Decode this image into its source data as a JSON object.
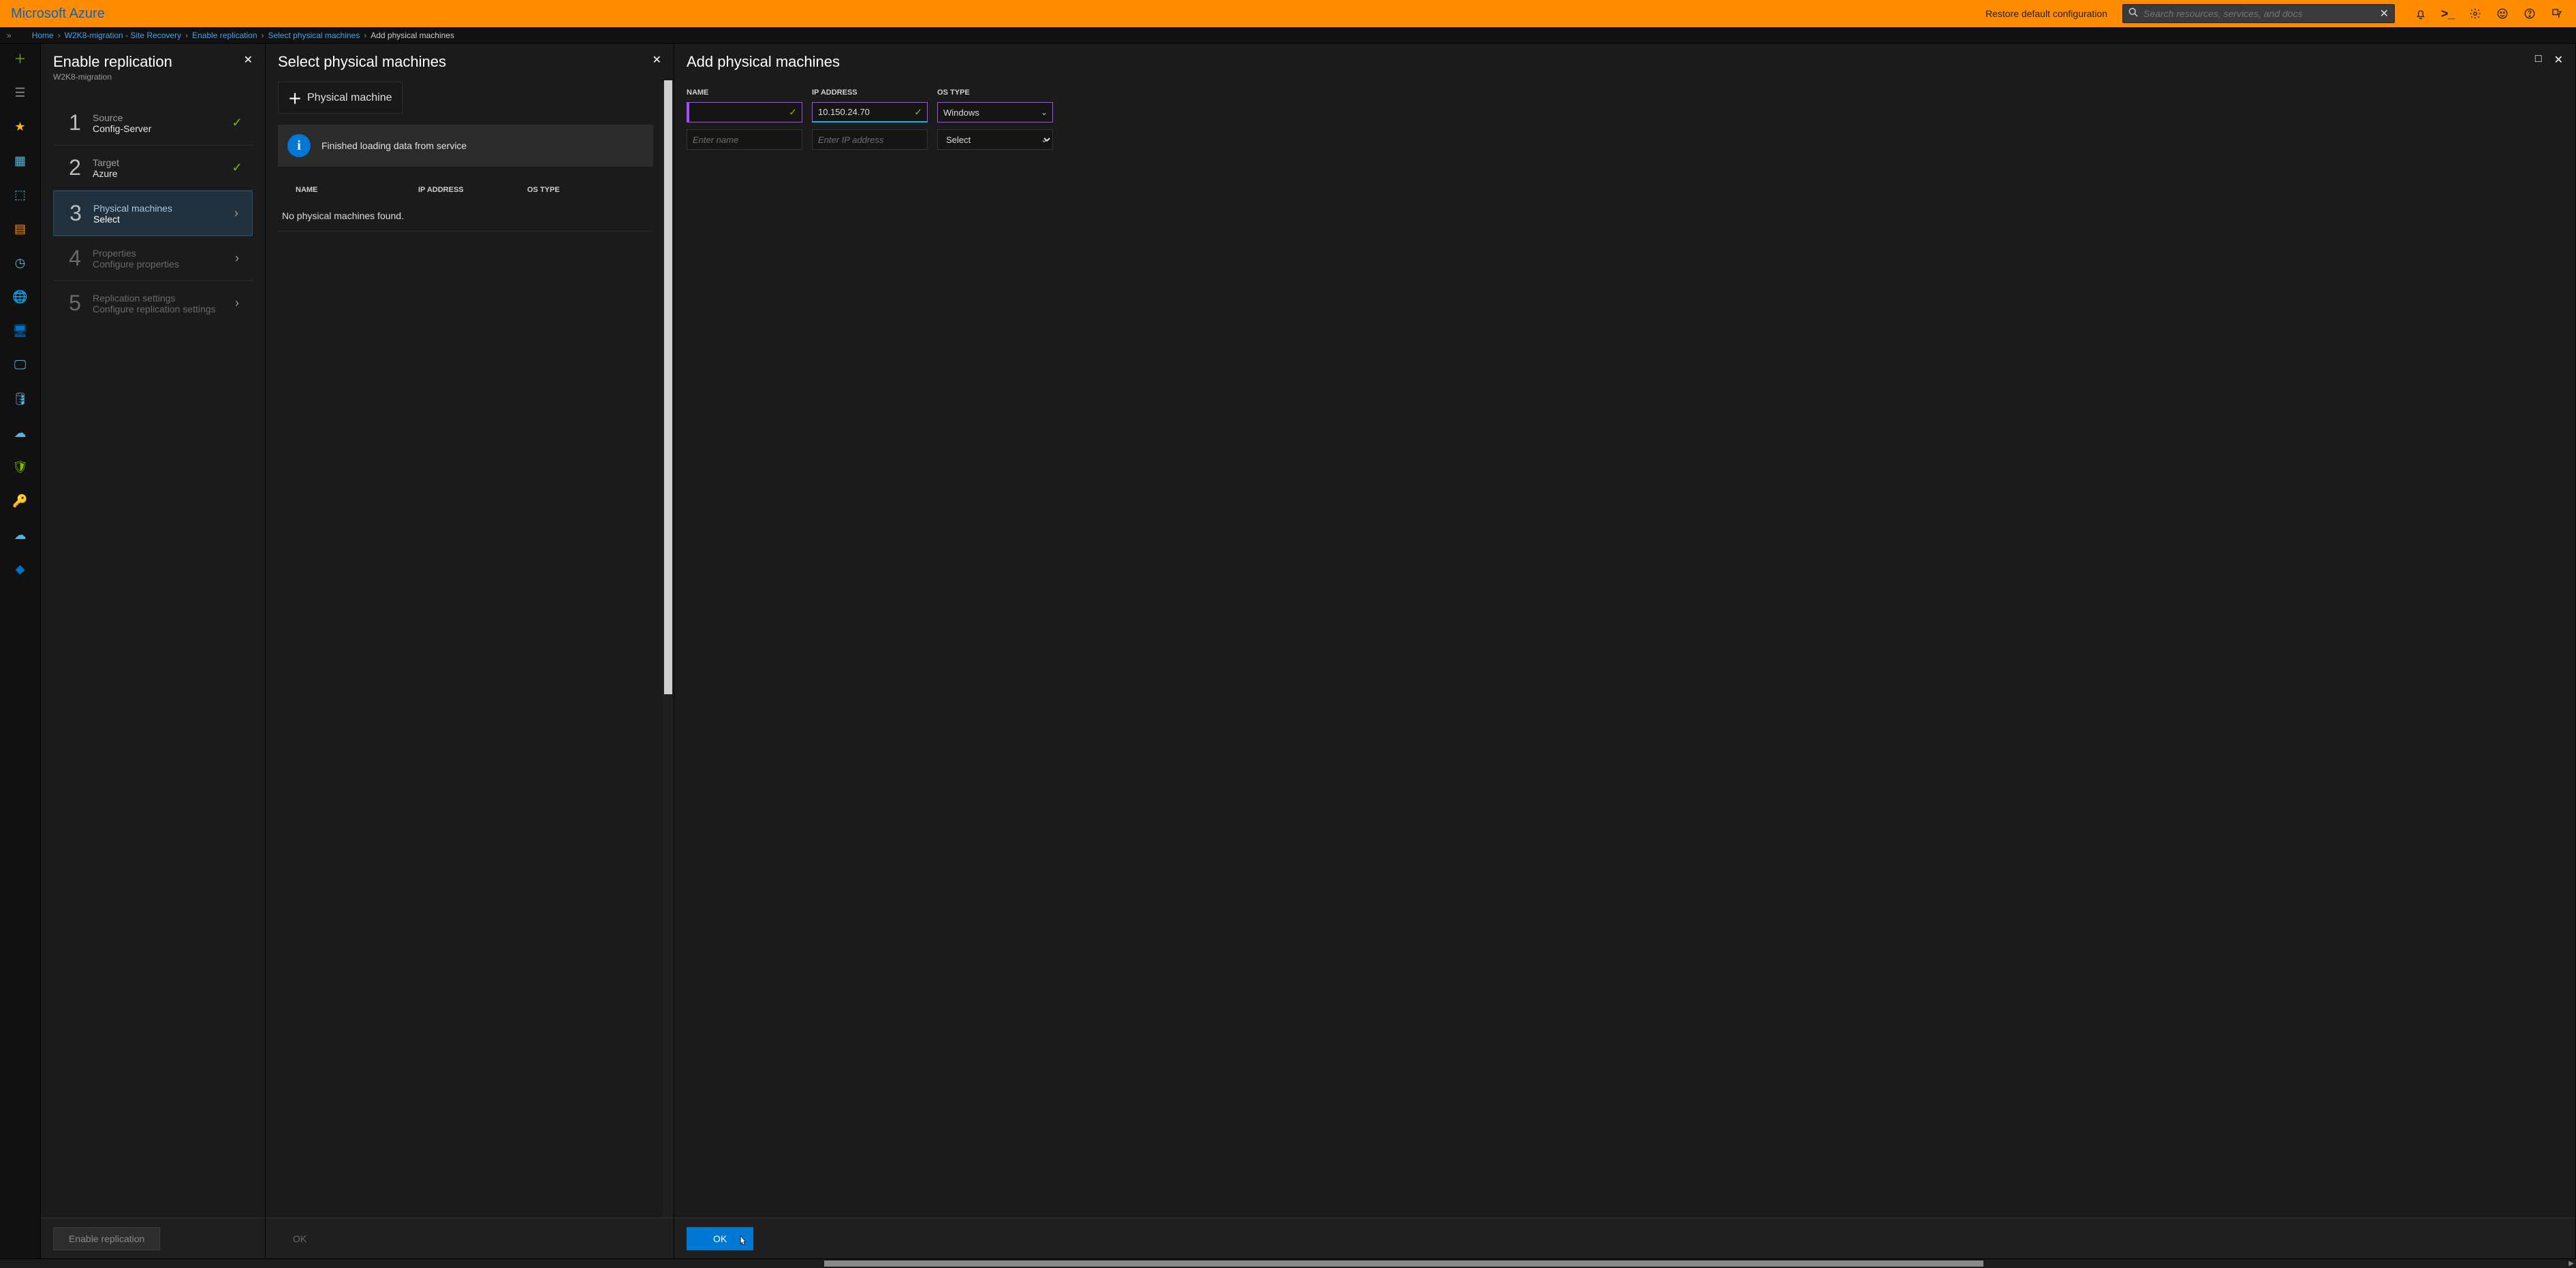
{
  "topbar": {
    "brand": "Microsoft Azure",
    "restore": "Restore default configuration",
    "search_placeholder": "Search resources, services, and docs"
  },
  "breadcrumb": {
    "items": [
      "Home",
      "W2K8-migration - Site Recovery",
      "Enable replication",
      "Select physical machines",
      "Add physical machines"
    ]
  },
  "blade1": {
    "title": "Enable replication",
    "subtitle": "W2K8-migration",
    "steps": [
      {
        "num": "1",
        "label": "Source",
        "value": "Config-Server",
        "status": "done"
      },
      {
        "num": "2",
        "label": "Target",
        "value": "Azure",
        "status": "done"
      },
      {
        "num": "3",
        "label": "Physical machines",
        "value": "Select",
        "status": "active"
      },
      {
        "num": "4",
        "label": "Properties",
        "value": "Configure properties",
        "status": "disabled"
      },
      {
        "num": "5",
        "label": "Replication settings",
        "value": "Configure replication settings",
        "status": "disabled"
      }
    ],
    "footer_btn": "Enable replication"
  },
  "blade2": {
    "title": "Select physical machines",
    "toolbar_add": "Physical machine",
    "banner": "Finished loading data from service",
    "cols": {
      "name": "NAME",
      "ip": "IP ADDRESS",
      "os": "OS TYPE"
    },
    "empty": "No physical machines found.",
    "footer_btn": "OK"
  },
  "blade3": {
    "title": "Add physical machines",
    "cols": {
      "name": "NAME",
      "ip": "IP ADDRESS",
      "os": "OS TYPE"
    },
    "row1": {
      "name": "",
      "ip": "10.150.24.70",
      "os": "Windows"
    },
    "row2": {
      "name_ph": "Enter name",
      "ip_ph": "Enter IP address",
      "os": "Select"
    },
    "footer_btn": "OK"
  }
}
